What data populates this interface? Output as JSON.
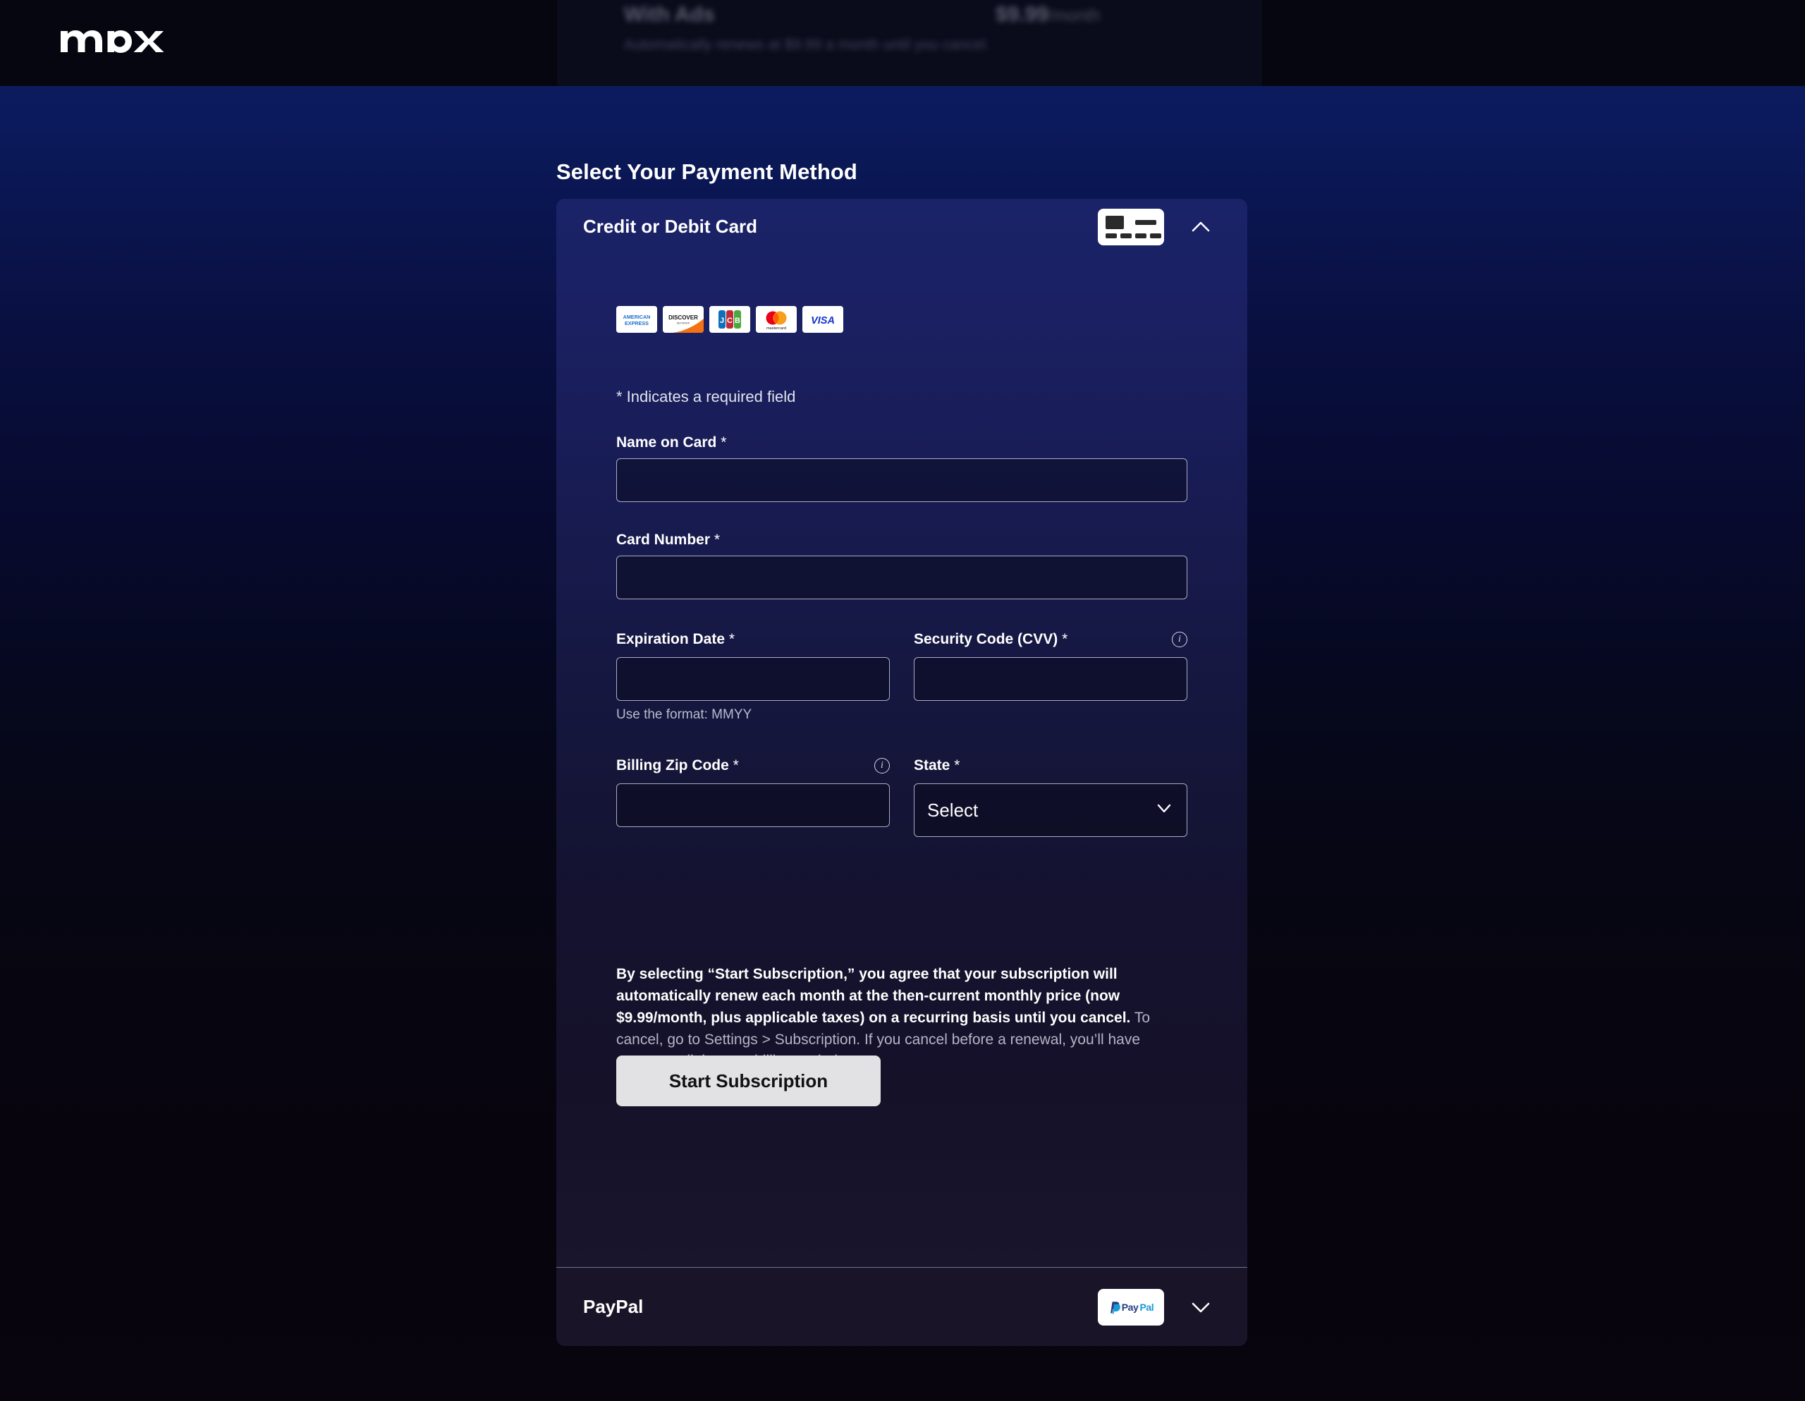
{
  "brand": {
    "logo_text": "max",
    "logo_icon": "max-wordmark-logo"
  },
  "top_plan_strip": {
    "plan_name": "With Ads",
    "plan_price": "$9.99",
    "plan_price_period": "/month",
    "plan_description": "Automatically renews at $9.99 a month until you cancel."
  },
  "page": {
    "heading": "Select Your Payment Method"
  },
  "credit_card_section": {
    "title": "Credit or Debit Card",
    "card_icon": "credit-card-icon",
    "toggle_icon": "chevron-up-icon",
    "expanded": true,
    "accepted_brands": [
      {
        "name": "american-express",
        "label": "AMERICAN EXPRESS"
      },
      {
        "name": "discover",
        "label": "DISCOVER",
        "sublabel": "NETWORK"
      },
      {
        "name": "jcb",
        "label": "JCB"
      },
      {
        "name": "mastercard",
        "label": "mastercard"
      },
      {
        "name": "visa",
        "label": "VISA"
      }
    ],
    "required_note": "* Indicates a required field",
    "fields": {
      "name_on_card": {
        "label": "Name on Card",
        "required_mark": "*",
        "value": "",
        "placeholder": ""
      },
      "card_number": {
        "label": "Card Number",
        "required_mark": "*",
        "value": "",
        "placeholder": ""
      },
      "expiration_date": {
        "label": "Expiration Date",
        "required_mark": "*",
        "value": "",
        "placeholder": "",
        "hint": "Use the format: MMYY"
      },
      "security_code": {
        "label": "Security Code (CVV)",
        "required_mark": "*",
        "value": "",
        "placeholder": "",
        "info_icon": "info-icon"
      },
      "billing_zip": {
        "label": "Billing Zip Code",
        "required_mark": "*",
        "value": "",
        "placeholder": "",
        "info_icon": "info-icon"
      },
      "state": {
        "label": "State",
        "required_mark": "*",
        "selected": "Select",
        "chevron_icon": "chevron-down-icon"
      }
    },
    "legal": {
      "bold_part": "By selecting “Start Subscription,” you agree that your subscription will automatically renew each month at the then-current monthly price (now $9.99/month, plus applicable taxes) on a recurring basis until you cancel.",
      "rest_part": " To cancel, go to Settings > Subscription. If you cancel before a renewal, you’ll have access until the next billing period."
    },
    "submit_button": "Start Subscription"
  },
  "paypal_section": {
    "title": "PayPal",
    "logo_text_a": "Pay",
    "logo_text_b": "Pal",
    "logo_icon": "paypal-logo",
    "toggle_icon": "chevron-down-icon",
    "expanded": false
  },
  "colors": {
    "page_gradient_top": "#0d1f66",
    "page_gradient_bottom": "#07050f",
    "panel_top": "#1b2368",
    "panel_bottom": "#18152c",
    "paypal_panel": "#191427",
    "button_bg": "#e2e2e5",
    "button_text": "#111111",
    "input_border": "#a9abc4",
    "text_primary": "#ffffff",
    "text_secondary": "#b3b5c7"
  }
}
